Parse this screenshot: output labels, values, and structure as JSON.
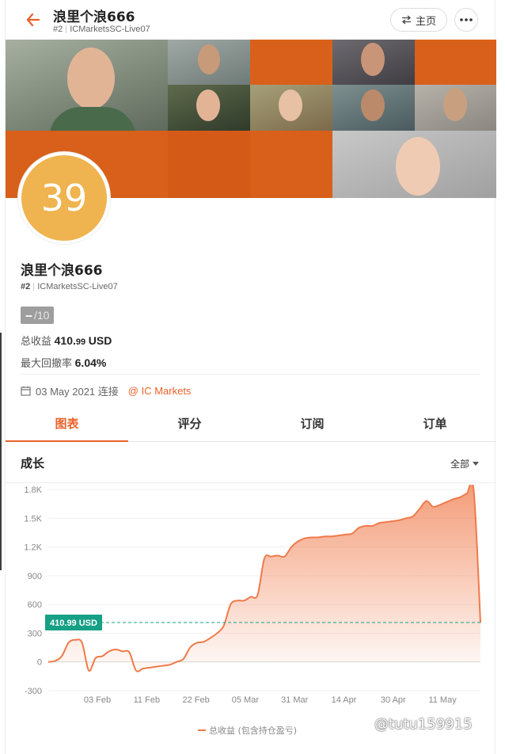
{
  "header": {
    "title": "浪里个浪666",
    "rank": "#2",
    "account": "ICMarketsSC-Live07",
    "home_label": "主页"
  },
  "profile": {
    "avatar_text": "39",
    "name": "浪里个浪666",
    "rank": "#2",
    "account": "ICMarketsSC-Live07",
    "score_value": "--",
    "score_total": "/10",
    "profit_label": "总收益",
    "profit_int": "410.",
    "profit_dec": "99",
    "profit_unit": "USD",
    "drawdown_label": "最大回撤率",
    "drawdown_value": "6.04%",
    "connected_text": "03 May 2021 连接",
    "broker": "@ IC Markets"
  },
  "tabs": [
    {
      "label": "图表",
      "active": true
    },
    {
      "label": "评分",
      "active": false
    },
    {
      "label": "订阅",
      "active": false
    },
    {
      "label": "订单",
      "active": false
    }
  ],
  "section": {
    "title": "成长",
    "range_label": "全部"
  },
  "chart_data": {
    "type": "area",
    "title": "",
    "xlabel": "",
    "ylabel": "",
    "ylim": [
      -300,
      1850
    ],
    "y_ticks": [
      -300,
      0,
      300,
      600,
      900,
      1200,
      1500,
      1800
    ],
    "y_tick_labels": [
      "-300",
      "0",
      "300",
      "600",
      "900",
      "1.2K",
      "1.5K",
      "1.8K"
    ],
    "x_tick_labels": [
      "03 Feb",
      "11 Feb",
      "22 Feb",
      "05 Mar",
      "31 Mar",
      "14 Apr",
      "30 Apr",
      "11 May"
    ],
    "current_value": 410.99,
    "current_label": "410.99 USD",
    "series": [
      {
        "name": "总收益 (包含持仓盈亏)",
        "color": "#f07a4a",
        "values": [
          0,
          10,
          60,
          200,
          230,
          200,
          -90,
          40,
          60,
          110,
          130,
          110,
          100,
          -90,
          -70,
          -60,
          -50,
          -40,
          -30,
          0,
          30,
          150,
          200,
          210,
          250,
          300,
          380,
          600,
          640,
          640,
          680,
          700,
          1080,
          1100,
          1110,
          1100,
          1200,
          1260,
          1290,
          1300,
          1300,
          1310,
          1310,
          1320,
          1330,
          1340,
          1400,
          1420,
          1420,
          1450,
          1460,
          1470,
          1480,
          1500,
          1520,
          1600,
          1680,
          1620,
          1640,
          1670,
          1700,
          1720,
          1760,
          1790,
          410
        ]
      }
    ],
    "legend": "bottom-center",
    "grid": true
  },
  "watermark": "@tutu159915",
  "colors": {
    "accent": "#e8622a",
    "avatar": "#efb34f",
    "badge": "#16a085"
  }
}
